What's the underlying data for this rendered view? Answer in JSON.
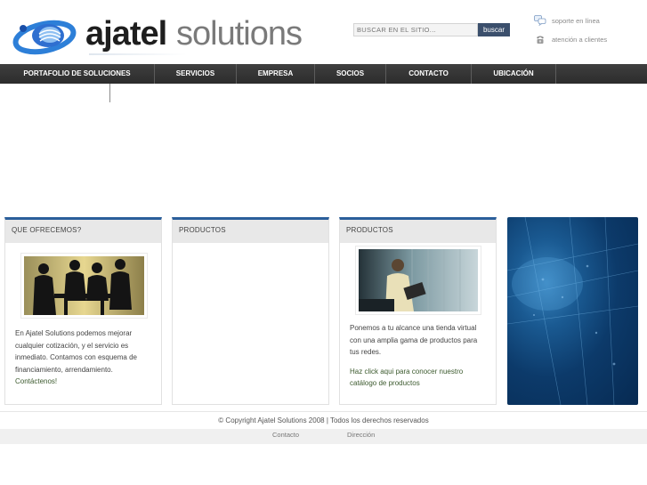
{
  "brand": {
    "word1": "ajatel",
    "word2": "solutions"
  },
  "search": {
    "placeholder": "BUSCAR EN EL SITIO...",
    "button_label": "buscar"
  },
  "quick_links": {
    "support": "soporte en línea",
    "clients": "atención a clientes"
  },
  "nav": {
    "items": [
      {
        "label": "PORTAFOLIO DE SOLUCIONES"
      },
      {
        "label": "SERVICIOS"
      },
      {
        "label": "EMPRESA"
      },
      {
        "label": "SOCIOS"
      },
      {
        "label": "CONTACTO"
      },
      {
        "label": "UBICACIÓN"
      }
    ]
  },
  "cards": [
    {
      "heading": "QUE OFRECEMOS?",
      "body": "En Ajatel Solutions podemos mejorar cualquier cotización, y el servicio es inmediato. Contamos con esquema de financiamiento, arrendamiento.",
      "link": "Contáctenos!"
    },
    {
      "heading": "PRODUCTOS"
    },
    {
      "heading": "PRODUCTOS",
      "body": "Ponemos a tu alcance una tienda virtual con una amplia gama de productos para tus redes.",
      "link": "Haz click aqui para conocer nuestro catálogo de productos"
    }
  ],
  "footer": {
    "copyright": "© Copyright Ajatel Solutions 2008 | Todos los derechos reservados",
    "contact_link": "Contacto",
    "address_link": "Dirección"
  },
  "colors": {
    "accent": "#2b5f9b",
    "nav_bg": "#333333",
    "search_button": "#3b4f6c",
    "link_green": "#3c5a2e"
  },
  "icons": {
    "support": "chat-bubbles-icon",
    "clients": "phone-icon",
    "logo": "globe-swirl-icon"
  }
}
